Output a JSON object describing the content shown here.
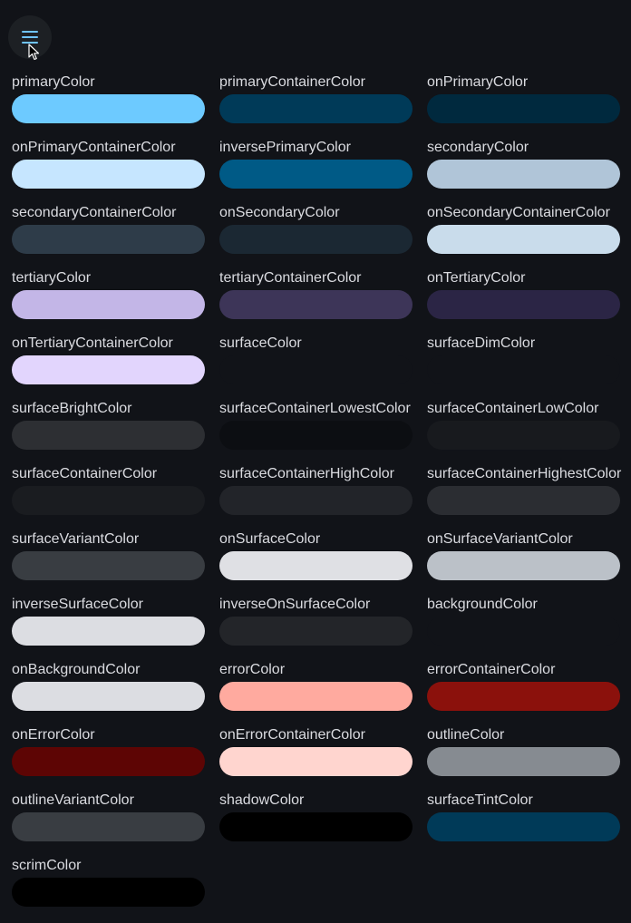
{
  "app": {
    "background": "#111318",
    "menu_icon": "menu-icon"
  },
  "swatches": [
    {
      "label": "primaryColor",
      "color": "#6dcaff"
    },
    {
      "label": "primaryContainerColor",
      "color": "#003a58"
    },
    {
      "label": "onPrimaryColor",
      "color": "#00293e"
    },
    {
      "label": "onPrimaryContainerColor",
      "color": "#c6e6ff"
    },
    {
      "label": "inversePrimaryColor",
      "color": "#005a86"
    },
    {
      "label": "secondaryColor",
      "color": "#b0c5d8"
    },
    {
      "label": "secondaryContainerColor",
      "color": "#2e3c49"
    },
    {
      "label": "onSecondaryColor",
      "color": "#1b2833"
    },
    {
      "label": "onSecondaryContainerColor",
      "color": "#c9dceb"
    },
    {
      "label": "tertiaryColor",
      "color": "#c3b6e7"
    },
    {
      "label": "tertiaryContainerColor",
      "color": "#3d3558"
    },
    {
      "label": "onTertiaryColor",
      "color": "#2b2545"
    },
    {
      "label": "onTertiaryContainerColor",
      "color": "#e2d5fd"
    },
    {
      "label": "surfaceColor",
      "color": "#111318"
    },
    {
      "label": "surfaceDimColor",
      "color": "#111318"
    },
    {
      "label": "surfaceBrightColor",
      "color": "#2d2f33"
    },
    {
      "label": "surfaceContainerLowestColor",
      "color": "#0c0e12"
    },
    {
      "label": "surfaceContainerLowColor",
      "color": "#181a1e"
    },
    {
      "label": "surfaceContainerColor",
      "color": "#1a1c20"
    },
    {
      "label": "surfaceContainerHighColor",
      "color": "#222429"
    },
    {
      "label": "surfaceContainerHighestColor",
      "color": "#2b2d32"
    },
    {
      "label": "surfaceVariantColor",
      "color": "#393d42"
    },
    {
      "label": "onSurfaceColor",
      "color": "#dfe0e4"
    },
    {
      "label": "onSurfaceVariantColor",
      "color": "#bbc1c8"
    },
    {
      "label": "inverseSurfaceColor",
      "color": "#dcdde2"
    },
    {
      "label": "inverseOnSurfaceColor",
      "color": "#232529"
    },
    {
      "label": "backgroundColor",
      "color": "#111318"
    },
    {
      "label": "onBackgroundColor",
      "color": "#dcdde2"
    },
    {
      "label": "errorColor",
      "color": "#ffaa9f"
    },
    {
      "label": "errorContainerColor",
      "color": "#8b110c"
    },
    {
      "label": "onErrorColor",
      "color": "#5d0504"
    },
    {
      "label": "onErrorContainerColor",
      "color": "#ffd5cf"
    },
    {
      "label": "outlineColor",
      "color": "#868b91"
    },
    {
      "label": "outlineVariantColor",
      "color": "#393d42"
    },
    {
      "label": "shadowColor",
      "color": "#000000"
    },
    {
      "label": "surfaceTintColor",
      "color": "#003a58"
    },
    {
      "label": "scrimColor",
      "color": "#000000"
    }
  ]
}
